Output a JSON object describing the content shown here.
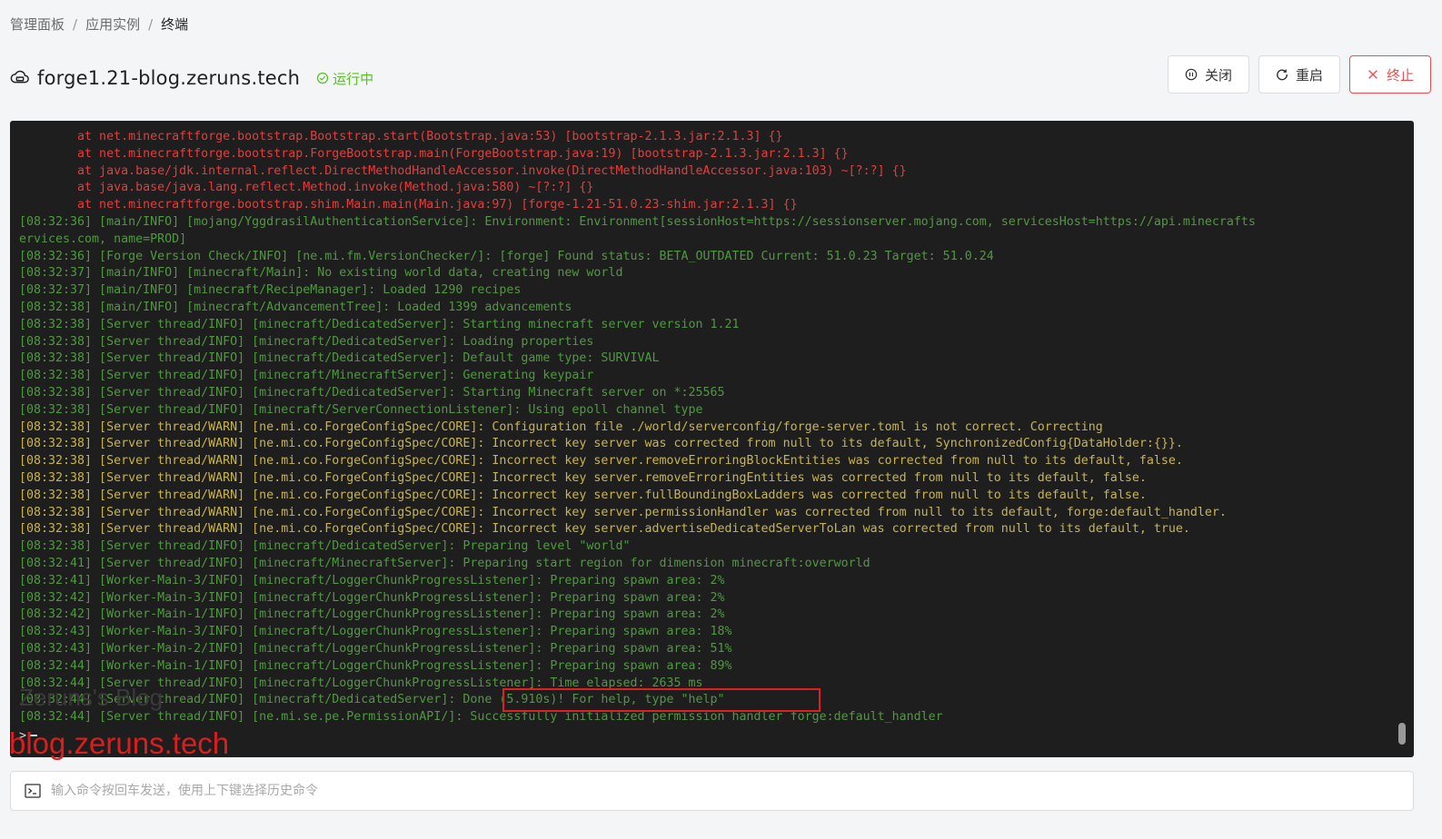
{
  "breadcrumb": {
    "items": [
      "管理面板",
      "应用实例",
      "终端"
    ],
    "separator": "/"
  },
  "header": {
    "title": "forge1.21-blog.zeruns.tech",
    "status_label": "运行中",
    "status_color": "#52c41a"
  },
  "actions": {
    "close_label": "关闭",
    "restart_label": "重启",
    "terminate_label": "终止"
  },
  "terminal": {
    "lines": [
      {
        "text": "        at net.minecraftforge.bootstrap.Bootstrap.start(Bootstrap.java:53) [bootstrap-2.1.3.jar:2.1.3] {}",
        "color": "red"
      },
      {
        "text": "        at net.minecraftforge.bootstrap.ForgeBootstrap.main(ForgeBootstrap.java:19) [bootstrap-2.1.3.jar:2.1.3] {}",
        "color": "red"
      },
      {
        "text": "        at java.base/jdk.internal.reflect.DirectMethodHandleAccessor.invoke(DirectMethodHandleAccessor.java:103) ~[?:?] {}",
        "color": "red"
      },
      {
        "text": "        at java.base/java.lang.reflect.Method.invoke(Method.java:580) ~[?:?] {}",
        "color": "red"
      },
      {
        "text": "        at net.minecraftforge.bootstrap.shim.Main.main(Main.java:97) [forge-1.21-51.0.23-shim.jar:2.1.3] {}",
        "color": "red"
      },
      {
        "text": "[08:32:36] [main/INFO] [mojang/YggdrasilAuthenticationService]: Environment: Environment[sessionHost=https://sessionserver.mojang.com, servicesHost=https://api.minecrafts",
        "color": "green"
      },
      {
        "text": "ervices.com, name=PROD]",
        "color": "green"
      },
      {
        "text": "[08:32:36] [Forge Version Check/INFO] [ne.mi.fm.VersionChecker/]: [forge] Found status: BETA_OUTDATED Current: 51.0.23 Target: 51.0.24",
        "color": "green"
      },
      {
        "text": "[08:32:37] [main/INFO] [minecraft/Main]: No existing world data, creating new world",
        "color": "green"
      },
      {
        "text": "[08:32:37] [main/INFO] [minecraft/RecipeManager]: Loaded 1290 recipes",
        "color": "green"
      },
      {
        "text": "[08:32:38] [main/INFO] [minecraft/AdvancementTree]: Loaded 1399 advancements",
        "color": "green"
      },
      {
        "text": "[08:32:38] [Server thread/INFO] [minecraft/DedicatedServer]: Starting minecraft server version 1.21",
        "color": "green"
      },
      {
        "text": "[08:32:38] [Server thread/INFO] [minecraft/DedicatedServer]: Loading properties",
        "color": "green"
      },
      {
        "text": "[08:32:38] [Server thread/INFO] [minecraft/DedicatedServer]: Default game type: SURVIVAL",
        "color": "green"
      },
      {
        "text": "[08:32:38] [Server thread/INFO] [minecraft/MinecraftServer]: Generating keypair",
        "color": "green"
      },
      {
        "text": "[08:32:38] [Server thread/INFO] [minecraft/DedicatedServer]: Starting Minecraft server on *:25565",
        "color": "green"
      },
      {
        "text": "[08:32:38] [Server thread/INFO] [minecraft/ServerConnectionListener]: Using epoll channel type",
        "color": "green"
      },
      {
        "text": "[08:32:38] [Server thread/WARN] [ne.mi.co.ForgeConfigSpec/CORE]: Configuration file ./world/serverconfig/forge-server.toml is not correct. Correcting",
        "color": "yellow"
      },
      {
        "text": "[08:32:38] [Server thread/WARN] [ne.mi.co.ForgeConfigSpec/CORE]: Incorrect key server was corrected from null to its default, SynchronizedConfig{DataHolder:{}}.",
        "color": "yellow"
      },
      {
        "text": "[08:32:38] [Server thread/WARN] [ne.mi.co.ForgeConfigSpec/CORE]: Incorrect key server.removeErroringBlockEntities was corrected from null to its default, false.",
        "color": "yellow"
      },
      {
        "text": "[08:32:38] [Server thread/WARN] [ne.mi.co.ForgeConfigSpec/CORE]: Incorrect key server.removeErroringEntities was corrected from null to its default, false.",
        "color": "yellow"
      },
      {
        "text": "[08:32:38] [Server thread/WARN] [ne.mi.co.ForgeConfigSpec/CORE]: Incorrect key server.fullBoundingBoxLadders was corrected from null to its default, false.",
        "color": "yellow"
      },
      {
        "text": "[08:32:38] [Server thread/WARN] [ne.mi.co.ForgeConfigSpec/CORE]: Incorrect key server.permissionHandler was corrected from null to its default, forge:default_handler.",
        "color": "yellow"
      },
      {
        "text": "[08:32:38] [Server thread/WARN] [ne.mi.co.ForgeConfigSpec/CORE]: Incorrect key server.advertiseDedicatedServerToLan was corrected from null to its default, true.",
        "color": "yellow"
      },
      {
        "text": "[08:32:38] [Server thread/INFO] [minecraft/DedicatedServer]: Preparing level \"world\"",
        "color": "green"
      },
      {
        "text": "[08:32:41] [Server thread/INFO] [minecraft/MinecraftServer]: Preparing start region for dimension minecraft:overworld",
        "color": "green"
      },
      {
        "text": "[08:32:41] [Worker-Main-3/INFO] [minecraft/LoggerChunkProgressListener]: Preparing spawn area: 2%",
        "color": "green"
      },
      {
        "text": "[08:32:42] [Worker-Main-3/INFO] [minecraft/LoggerChunkProgressListener]: Preparing spawn area: 2%",
        "color": "green"
      },
      {
        "text": "[08:32:42] [Worker-Main-1/INFO] [minecraft/LoggerChunkProgressListener]: Preparing spawn area: 2%",
        "color": "green"
      },
      {
        "text": "[08:32:43] [Worker-Main-3/INFO] [minecraft/LoggerChunkProgressListener]: Preparing spawn area: 18%",
        "color": "green"
      },
      {
        "text": "[08:32:43] [Worker-Main-2/INFO] [minecraft/LoggerChunkProgressListener]: Preparing spawn area: 51%",
        "color": "green"
      },
      {
        "text": "[08:32:44] [Worker-Main-1/INFO] [minecraft/LoggerChunkProgressListener]: Preparing spawn area: 89%",
        "color": "green"
      },
      {
        "text": "[08:32:44] [Server thread/INFO] [minecraft/LoggerChunkProgressListener]: Time elapsed: 2635 ms",
        "color": "green"
      },
      {
        "text": "[08:32:44] [Server thread/INFO] [minecraft/DedicatedServer]: Done (5.910s)! For help, type \"help\"",
        "color": "green"
      },
      {
        "text": "[08:32:44] [Server thread/INFO] [ne.mi.se.pe.PermissionAPI/]: Successfully initialized permission handler forge:default_handler",
        "color": "green"
      }
    ],
    "prompt": ">",
    "colors": {
      "red": "#ea3b3b",
      "green": "#4e9a3d",
      "yellow": "#c9b44a",
      "background": "#1e1e1e"
    }
  },
  "watermark": {
    "line1": "Zeruns's Blog",
    "line2": "blog.zeruns.tech"
  },
  "command_input": {
    "placeholder": "输入命令按回车发送，使用上下键选择历史命令",
    "value": ""
  }
}
